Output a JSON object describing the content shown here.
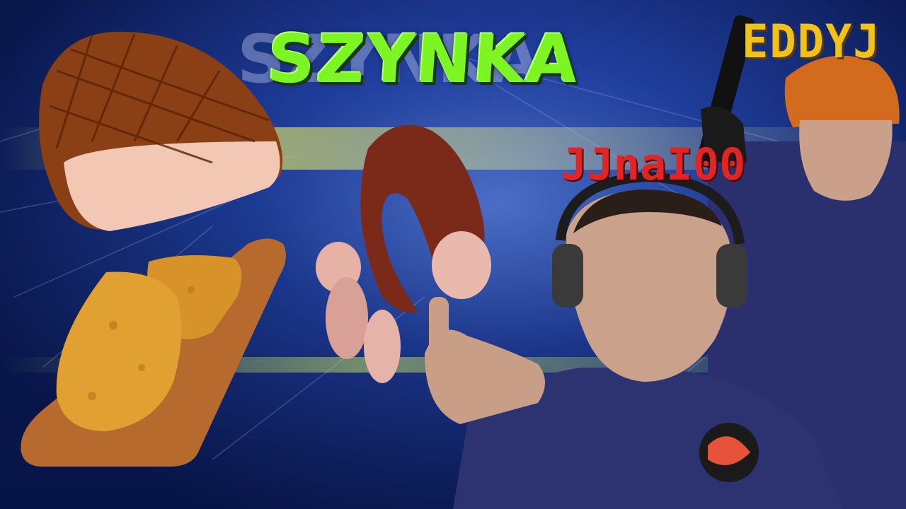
{
  "title": "SZYNKA",
  "labels": {
    "top_right": "EDDYJ",
    "center_right": "JJnaI00"
  },
  "colors": {
    "title": "#7cf523",
    "top_right_label": "#f0c21a",
    "center_right_label": "#e02525",
    "background": "#14307e"
  }
}
